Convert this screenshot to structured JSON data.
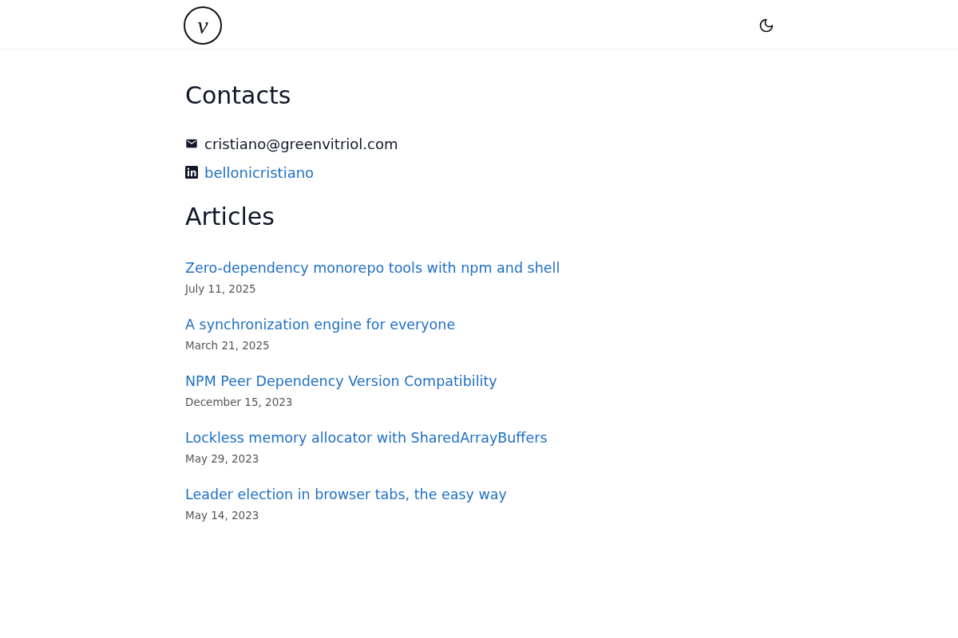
{
  "header": {
    "logo": "v"
  },
  "contacts": {
    "title": "Contacts",
    "items": [
      {
        "kind": "email",
        "text": "cristiano@greenvitriol.com"
      },
      {
        "kind": "linkedin",
        "text": "bellonicristiano"
      }
    ]
  },
  "articles": {
    "title": "Articles",
    "items": [
      {
        "title": "Zero-dependency monorepo tools with npm and shell",
        "date": "July 11, 2025"
      },
      {
        "title": "A synchronization engine for everyone",
        "date": "March 21, 2025"
      },
      {
        "title": "NPM Peer Dependency Version Compatibility",
        "date": "December 15, 2023"
      },
      {
        "title": "Lockless memory allocator with SharedArrayBuffers",
        "date": "May 29, 2023"
      },
      {
        "title": "Leader election in browser tabs, the easy way",
        "date": "May 14, 2023"
      }
    ]
  }
}
